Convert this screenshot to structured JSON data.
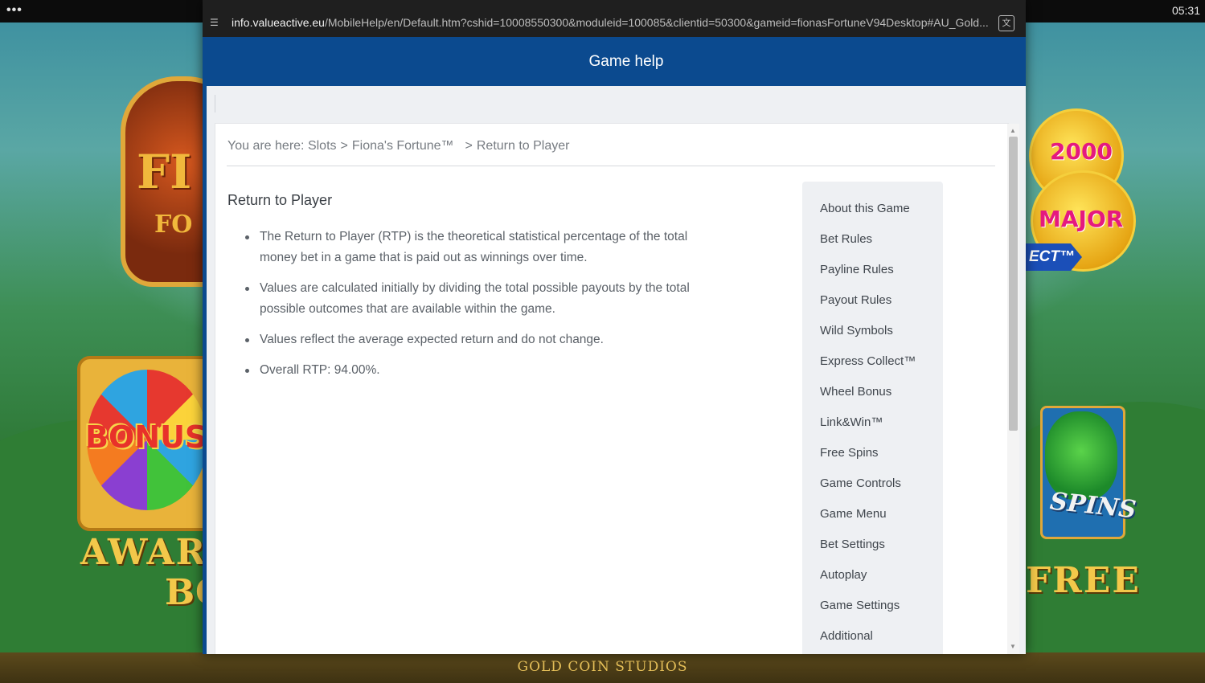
{
  "system": {
    "clock": "05:31",
    "menu_dots": "•••"
  },
  "game": {
    "studio": "GOLD COIN STUDIOS",
    "logo_text_top": "FI",
    "logo_text_bottom": "FO",
    "bonus_label": "BONUS",
    "award_label_1": "AWARD",
    "award_label_2": "BO",
    "jackpot_value": "2000",
    "jackpot_major": "MAJOR",
    "express_badge": "ECT™",
    "spins_label": "SPINS",
    "free_label": "FREE"
  },
  "browser": {
    "url_host": "info.valueactive.eu",
    "url_path": "/MobileHelp/en/Default.htm?cshid=10008550300&moduleid=100085&clientid=50300&gameid=fionasFortuneV94Desktop#AU_Gold...",
    "site_icon": "tune-icon",
    "translate_icon": "translate-icon"
  },
  "app": {
    "title": "Game help"
  },
  "breadcrumb": {
    "prefix": "You are here:",
    "items": [
      "Slots",
      "Fiona's Fortune™",
      "Return to Player"
    ]
  },
  "article": {
    "heading": "Return to Player",
    "bullets": [
      "The Return to Player (RTP) is the theoretical statistical percentage of the total money bet in a game that is paid out as winnings over time.",
      "Values are calculated initially by dividing the total possible payouts by the total possible outcomes that are available within the game.",
      "Values reflect the average expected return and do not change.",
      "Overall RTP: 94.00%."
    ]
  },
  "sidenav": {
    "items": [
      "About this Game",
      "Bet Rules",
      "Payline Rules",
      "Payout Rules",
      "Wild Symbols",
      "Express Collect™",
      "Wheel Bonus",
      "Link&Win™",
      "Free Spins",
      "Game Controls",
      "Game Menu",
      "Bet Settings",
      "Autoplay",
      "Game Settings",
      "Additional"
    ]
  },
  "colors": {
    "appbar": "#0b4a8f",
    "content_text": "#5b6168",
    "nav_bg": "#eef0f3"
  }
}
